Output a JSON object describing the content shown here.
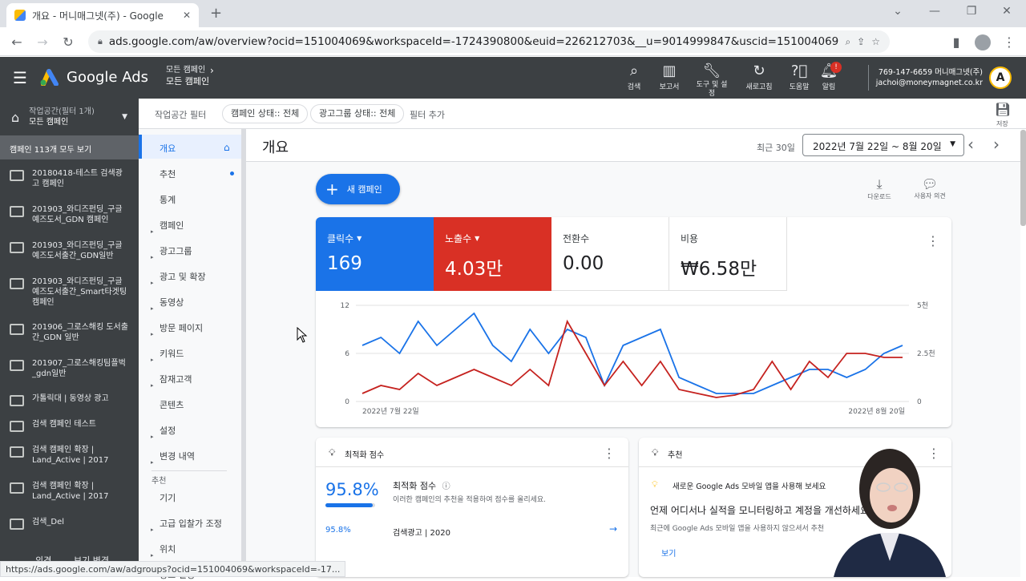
{
  "browser": {
    "tab_title": "개요 - 머니매그넷(주) - Google",
    "url": "ads.google.com/aw/overview?ocid=151004069&workspaceId=-1724390800&euid=226212703&__u=9014999847&uscid=151004069&__c=32214...",
    "status_url": "https://ads.google.com/aw/adgroups?ocid=151004069&workspaceId=-17..."
  },
  "header": {
    "product": "Google Ads",
    "breadcrumb_top": "모든 캠페인",
    "breadcrumb_current": "모든 캠페인",
    "tools": [
      {
        "icon": "search-icon",
        "label": "검색"
      },
      {
        "icon": "reports-icon",
        "label": "보고서"
      },
      {
        "icon": "wrench-icon",
        "label": "도구 및 설정"
      },
      {
        "icon": "refresh-icon",
        "label": "새로고침"
      },
      {
        "icon": "help-icon",
        "label": "도움말"
      },
      {
        "icon": "bell-icon",
        "label": "알림"
      }
    ],
    "account_id": "769-147-6659 머니매그넷(주)",
    "account_email": "jachoi@moneymagnet.co.kr"
  },
  "left": {
    "workspace_label": "작업공간(필터 1개)",
    "workspace_value": "모든 캠페인",
    "view_all": "캠페인 113개 모두 보기",
    "campaigns": [
      "20180418-테스트 검색광고 캠페인",
      "201903_와디즈펀딩_구글예즈도서_GDN 캠페인",
      "201903_와디즈펀딩_구글예즈도서출간_GDN일반",
      "201903_와디즈펀딩_구글예즈도서출간_Smart타겟팅 캠페인",
      "201906_그로스해킹 도서출간_GDN 일반",
      "201907_그로스해킹팀플벅_gdn일반",
      "가톨릭대 | 동영상 광고",
      "검색 캠페인 테스트",
      "검색 캠페인 확장 | Land_Active | 2017",
      "검색 캠페인 확장 | Land_Active | 2017",
      "검색_Del"
    ],
    "bottom": [
      "의견",
      "보기 변경"
    ]
  },
  "navcol": {
    "items": [
      "개요",
      "추천",
      "통계",
      "캠페인",
      "광고그룹",
      "광고 및 확장",
      "동영상",
      "방문 페이지",
      "키워드",
      "잠재고객",
      "콘텐츠",
      "설정",
      "변경 내역"
    ],
    "section": "추천",
    "items2": [
      "기기",
      "고급 입찰가 조정",
      "위치",
      "광고 일정"
    ]
  },
  "filters": {
    "label": "작업공간 필터",
    "chip1": "캠페인 상태:: 전체",
    "chip2": "광고그룹 상태:: 전체",
    "add": "필터 추가",
    "save": "저장"
  },
  "page": {
    "title": "개요",
    "range_label": "최근 30일",
    "range": "2022년 7월 22일 ~ 8월 20일",
    "new_campaign": "새 캠페인",
    "download": "다운로드",
    "feedback": "사용자 의견"
  },
  "metrics": [
    {
      "label": "클릭수",
      "value": "169",
      "color": "#1a73e8"
    },
    {
      "label": "노출수",
      "value": "4.03만",
      "color": "#d93025"
    },
    {
      "label": "전환수",
      "value": "0.00"
    },
    {
      "label": "비용",
      "value": "₩6.58만"
    }
  ],
  "chart_data": {
    "type": "line",
    "x_start": "2022년 7월 22일",
    "x_end": "2022년 8월 20일",
    "y_left_ticks": [
      "12",
      "6",
      "0"
    ],
    "y_right_ticks": [
      "5천",
      "2.5천",
      "0"
    ],
    "ylim_left": [
      0,
      12
    ],
    "ylim_right": [
      0,
      5000
    ],
    "series": [
      {
        "name": "클릭수",
        "axis": "left",
        "color": "#1a73e8",
        "values": [
          7,
          8,
          6,
          10,
          7,
          9,
          11,
          7,
          5,
          9,
          6,
          9,
          8,
          2,
          7,
          8,
          9,
          3,
          2,
          1,
          1,
          1,
          2,
          3,
          4,
          4,
          3,
          4,
          6,
          7
        ]
      },
      {
        "name": "노출수",
        "axis": "left",
        "color": "#c5221f",
        "values": [
          1,
          2,
          1.5,
          3.5,
          2,
          3,
          4,
          3,
          2,
          4,
          2,
          10,
          6,
          2,
          5,
          2,
          5,
          1.5,
          1,
          0.5,
          0.8,
          1.5,
          5,
          1.5,
          5,
          3,
          6,
          6,
          5.5,
          5.5
        ]
      }
    ]
  },
  "optimization": {
    "title": "최적화 점수",
    "score": "95.8%",
    "score_value": 0.958,
    "heading": "최적화 점수",
    "desc": "이러한 캠페인의 추천을 적용하여 점수를 올리세요.",
    "row_score": "95.8%",
    "row_label": "검색광고 | 2020"
  },
  "recommend": {
    "title": "추천",
    "tip": "새로운 Google Ads 모바일 앱을 사용해 보세요",
    "heading": "언제 어디서나 실적을 모니터링하고 계정을 개선하세요",
    "desc": "최근에 Google Ads 모바일 앱을 사용하지 않으셔서 추천",
    "link": "보기"
  }
}
